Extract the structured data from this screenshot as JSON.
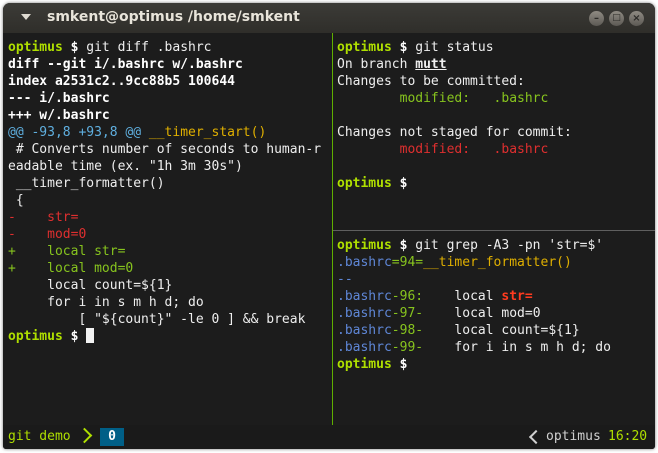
{
  "window": {
    "title": "smkent@optimus /home/smkent",
    "buttons": {
      "minimize": "–",
      "maximize": "□",
      "close": "×"
    }
  },
  "left_pane": {
    "prompt_host": "optimus",
    "prompt_sym": "$",
    "command": " git diff .bashrc",
    "diff_header": [
      "diff --git i/.bashrc w/.bashrc",
      "index a2531c2..9cc88b5 100644",
      "--- i/.bashrc",
      "+++ w/.bashrc"
    ],
    "hunk": {
      "range": "@@ -93,8 +93,8 @@",
      "context": " __timer_start()"
    },
    "context_lines": [
      " # Converts number of seconds to human-r",
      "eadable time (ex. \"1h 3m 30s\")",
      " __timer_formatter()",
      " {"
    ],
    "removed": [
      {
        "sign": "-",
        "text": "    str="
      },
      {
        "sign": "-",
        "text": "    mod=0"
      }
    ],
    "added": [
      {
        "sign": "+",
        "text": "    local str="
      },
      {
        "sign": "+",
        "text": "    local mod=0"
      }
    ],
    "trailing_lines": [
      "     local count=${1}",
      "     for i in s m h d; do",
      "         [ \"${count}\" -le 0 ] && break"
    ]
  },
  "right_top": {
    "prompt_host": "optimus",
    "prompt_sym": "$",
    "command": " git status",
    "branch_prefix": "On branch ",
    "branch_name": "mutt",
    "staged_header": "Changes to be committed:",
    "staged_label": "        modified:   ",
    "staged_file": ".bashrc",
    "unstaged_header": "Changes not staged for commit:",
    "unstaged_label": "        modified:   ",
    "unstaged_file": ".bashrc"
  },
  "right_bottom": {
    "prompt_host": "optimus",
    "prompt_sym": "$",
    "command": " git grep -A3 -pn 'str=$'",
    "func_file": ".bashrc",
    "func_sep": "=94=",
    "func_name": "__timer_formatter()",
    "group_sep": "--",
    "matches": [
      {
        "file": ".bashrc",
        "sep1": "-",
        "num": "96",
        "sep2": ":",
        "pad": "    ",
        "text": "local ",
        "match": "str="
      },
      {
        "file": ".bashrc",
        "sep1": "-",
        "num": "97",
        "sep2": "-",
        "pad": "    ",
        "text": "local mod=0",
        "match": ""
      },
      {
        "file": ".bashrc",
        "sep1": "-",
        "num": "98",
        "sep2": "-",
        "pad": "    ",
        "text": "local count=${1}",
        "match": ""
      },
      {
        "file": ".bashrc",
        "sep1": "-",
        "num": "99",
        "sep2": "-",
        "pad": "    ",
        "text": "for i in s m h d; do",
        "match": ""
      }
    ]
  },
  "statusbar": {
    "session": "git demo",
    "window_index": "0",
    "host": "optimus",
    "time": "16:20"
  },
  "colors": {
    "prompt": "#afdf00",
    "hunk": "#5fafdf",
    "func": "#dfaf00",
    "removed": "#df2f2f",
    "added": "#87c41e",
    "grep_file": "#5f87d7",
    "grep_match": "#ff3b1f",
    "pane_border_active": "#5faf00",
    "status_window_bg": "#005f87"
  }
}
